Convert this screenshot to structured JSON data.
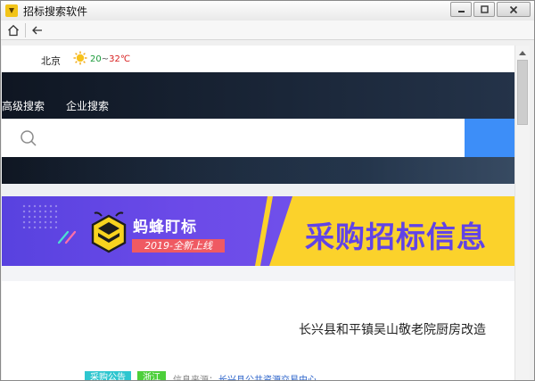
{
  "window": {
    "title": "招标搜索软件",
    "icon": "app-logo-icon"
  },
  "toolbar": {
    "home_icon": "home-icon",
    "back_icon": "back-arrow-icon"
  },
  "weather": {
    "city": "北京",
    "icon": "sun-icon",
    "temp_low": "20",
    "temp_sep": "~",
    "temp_high": "32℃"
  },
  "search": {
    "tabs": [
      "高级搜索",
      "企业搜索"
    ],
    "placeholder": "",
    "value": "",
    "button_color": "#3d8ef8"
  },
  "banner": {
    "brand": "蚂蜂盯标",
    "tagline": "2019-全新上线",
    "headline": "采购招标信息",
    "colors": {
      "purple": "#6b4ae8",
      "yellow": "#fbd22b",
      "tag": "#ef5a62"
    }
  },
  "listing": {
    "title": "长兴县和平镇吴山敬老院厨房改造",
    "type_tag": "采购公告",
    "region_tag": "浙江",
    "source_label": "信息来源：",
    "source_value": "长兴县公共资源交易中心"
  }
}
